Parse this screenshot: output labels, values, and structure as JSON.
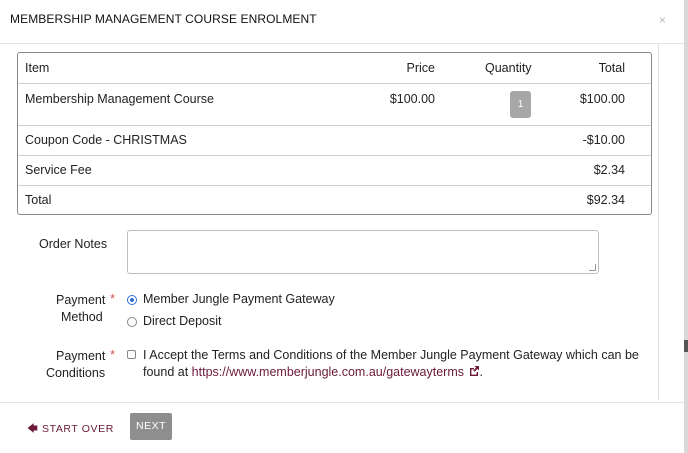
{
  "modal": {
    "title": "MEMBERSHIP MANAGEMENT COURSE ENROLMENT",
    "close_glyph": "×"
  },
  "table": {
    "headers": {
      "item": "Item",
      "price": "Price",
      "quantity": "Quantity",
      "total": "Total"
    },
    "item_row": {
      "item": "Membership Management Course",
      "price": "$100.00",
      "quantity": "1",
      "total": "$100.00"
    },
    "coupon_row": {
      "label": "Coupon Code - CHRISTMAS",
      "total": "-$10.00"
    },
    "fee_row": {
      "label": "Service Fee",
      "total": "$2.34"
    },
    "total_row": {
      "label": "Total",
      "total": "$92.34"
    }
  },
  "form": {
    "order_notes": {
      "label": "Order Notes",
      "value": ""
    },
    "payment_method": {
      "label_line1": "Payment",
      "label_line2": "Method",
      "required_mark": "*",
      "options": [
        {
          "label": "Member Jungle Payment Gateway",
          "selected": true
        },
        {
          "label": "Direct Deposit",
          "selected": false
        }
      ]
    },
    "payment_conditions": {
      "label_line1": "Payment",
      "label_line2": "Conditions",
      "required_mark": "*",
      "checked": false,
      "text": "I Accept the Terms and Conditions of the Member Jungle Payment Gateway which can be found at",
      "link_text": "https://www.memberjungle.com.au/gatewayterms",
      "after_link": "."
    }
  },
  "footer": {
    "start_over_arrow": "🡄",
    "start_over_label": "START OVER",
    "next_label": "NEXT"
  },
  "colors": {
    "accent_link": "#6b1a3a",
    "radio_selected": "#2f6fd6",
    "required": "#d9534f",
    "next_button_bg": "#8e8e8e",
    "qty_badge_bg": "#a7a7a7"
  },
  "icons": {
    "close": "close-icon",
    "external_link": "external-link-icon",
    "start_over": "arrow-left-icon"
  }
}
